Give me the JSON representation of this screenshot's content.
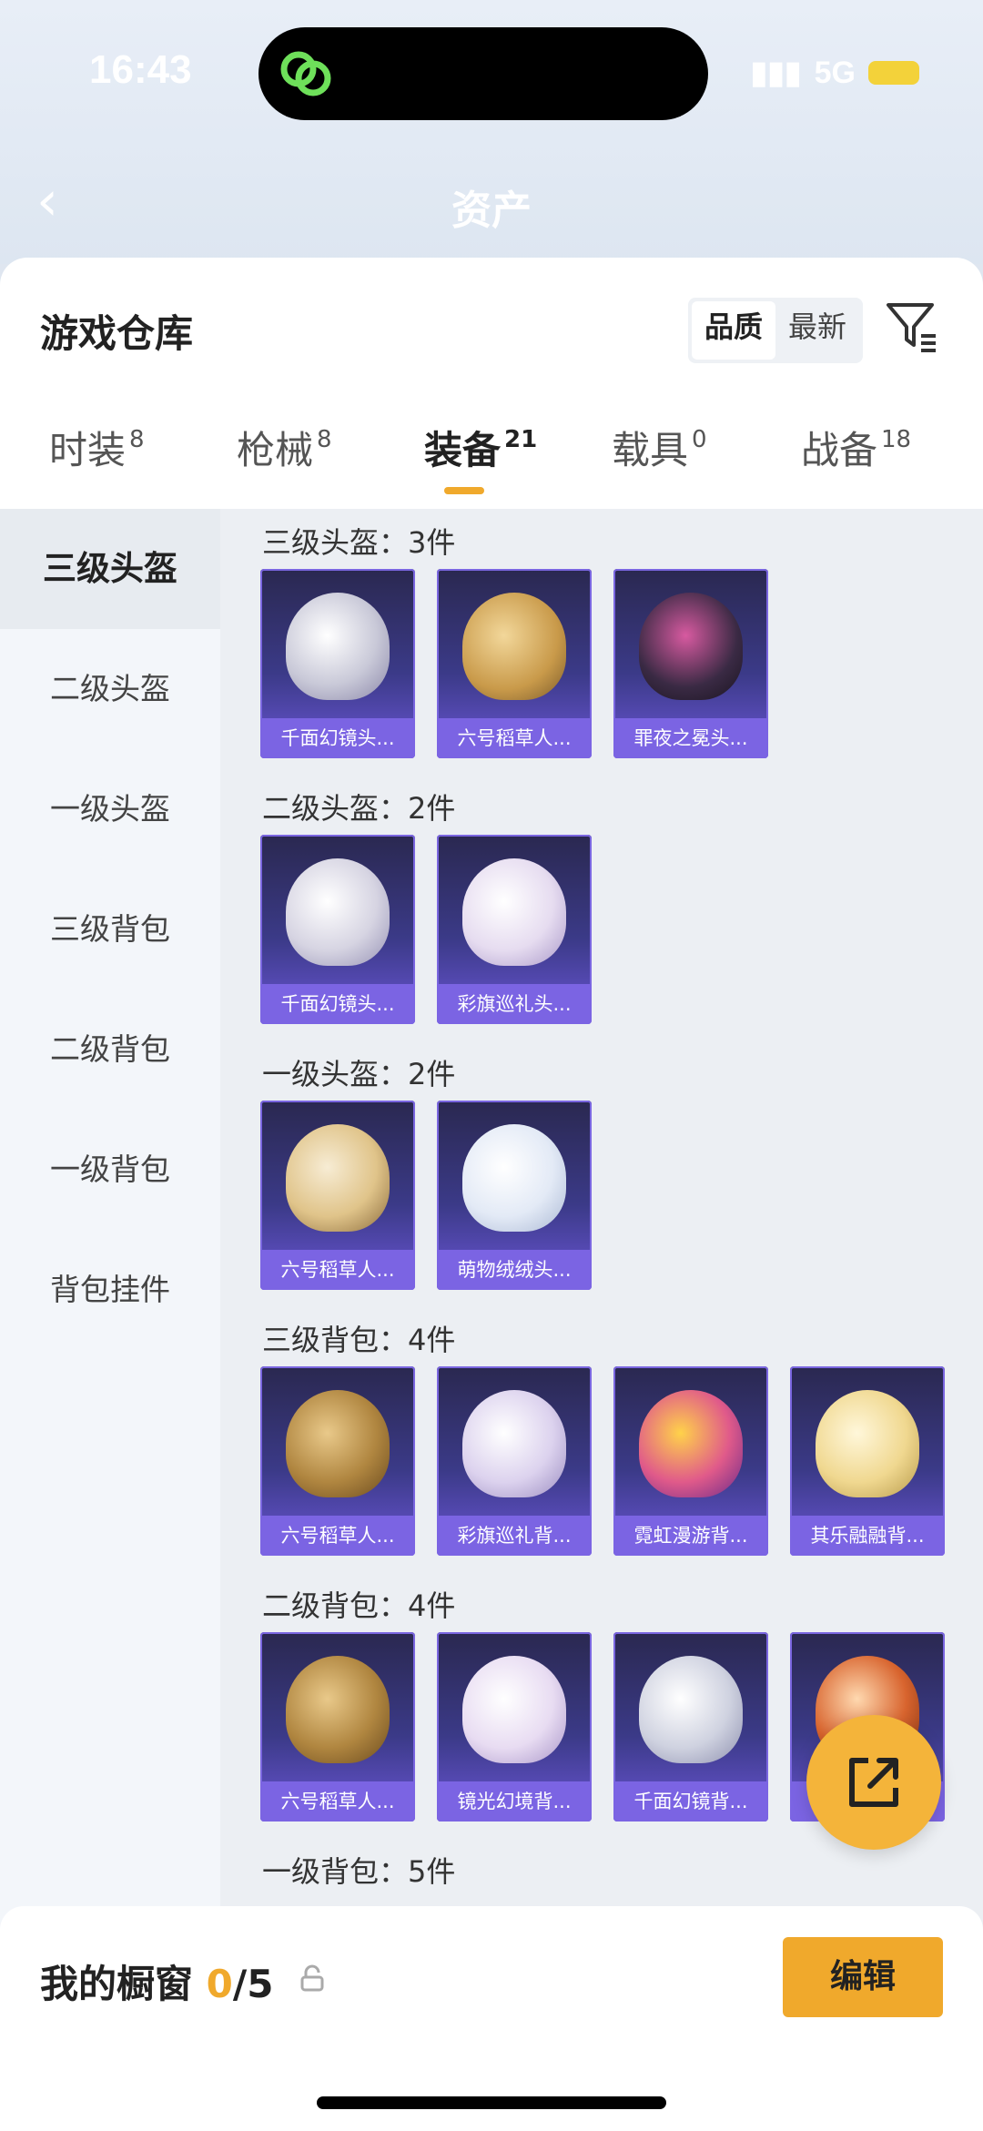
{
  "status": {
    "time": "16:43",
    "network": "5G"
  },
  "header": {
    "title": "资产"
  },
  "sheet": {
    "title": "游戏仓库",
    "sort": [
      "品质",
      "最新"
    ],
    "tabs": [
      {
        "label": "时装",
        "count": "8"
      },
      {
        "label": "枪械",
        "count": "8"
      },
      {
        "label": "装备",
        "count": "21"
      },
      {
        "label": "载具",
        "count": "0"
      },
      {
        "label": "战备",
        "count": "18"
      }
    ],
    "sidebar": [
      "三级头盔",
      "二级头盔",
      "一级头盔",
      "三级背包",
      "二级背包",
      "一级背包",
      "背包挂件"
    ],
    "sections": [
      {
        "title": "三级头盔：3件",
        "items": [
          "千面幻镜头...",
          "六号稻草人...",
          "罪夜之冕头..."
        ]
      },
      {
        "title": "二级头盔：2件",
        "items": [
          "千面幻镜头...",
          "彩旗巡礼头..."
        ]
      },
      {
        "title": "一级头盔：2件",
        "items": [
          "六号稻草人...",
          "萌物绒绒头..."
        ]
      },
      {
        "title": "三级背包：4件",
        "items": [
          "六号稻草人...",
          "彩旗巡礼背...",
          "霓虹漫游背...",
          "其乐融融背..."
        ]
      },
      {
        "title": "二级背包：4件",
        "items": [
          "六号稻草人...",
          "镜光幻境背...",
          "千面幻镜背...",
          "..."
        ]
      },
      {
        "title": "一级背包：5件",
        "items": []
      }
    ]
  },
  "showcase": {
    "title": "我的橱窗",
    "current": "0",
    "total": "/5",
    "edit": "编辑"
  },
  "colors": {
    "accent": "#f0a92c",
    "card_bottom": "#7b64e3"
  }
}
